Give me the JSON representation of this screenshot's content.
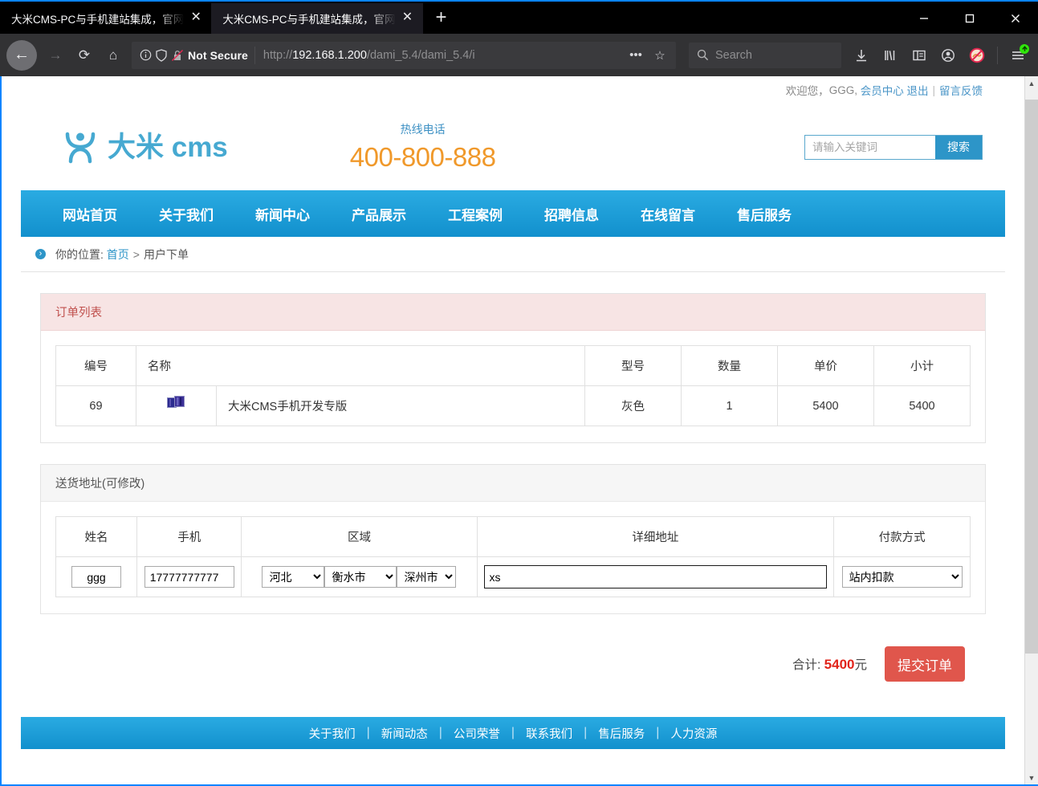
{
  "browser": {
    "tabs": [
      {
        "title": "大米CMS-PC与手机建站集成，官网",
        "close": "✕",
        "active": false
      },
      {
        "title": "大米CMS-PC与手机建站集成，官网",
        "close": "✕",
        "active": true
      }
    ],
    "new_tab_label": "+",
    "window_controls": {
      "minimize": "minimize-icon",
      "maximize": "maximize-icon",
      "close": "close-icon"
    },
    "nav": {
      "back": "←",
      "forward": "→",
      "reload": "⟳",
      "home": "⌂"
    },
    "address": {
      "security_label": "Not Secure",
      "url_scheme": "http://",
      "url_host": "192.168.1.200",
      "url_path": "/dami_5.4/dami_5.4/i",
      "page_actions": "•••",
      "bookmark": "☆"
    },
    "search": {
      "placeholder": "Search"
    },
    "toolbar_icons": [
      "downloads-icon",
      "library-icon",
      "sidebar-icon",
      "account-icon",
      "tracking-blocked-icon",
      "app-menu-icon"
    ]
  },
  "site": {
    "topbar": {
      "welcome": "欢迎您，",
      "username": "GGG,",
      "member_center": "会员中心",
      "logout": "退出",
      "divider": "|",
      "feedback": "留言反馈"
    },
    "logo": {
      "text": "大米 cms",
      "mark": "dami-logo-icon"
    },
    "hotline": {
      "label": "热线电话",
      "number": "400-800-888"
    },
    "search": {
      "placeholder": "请输入关键词",
      "button": "搜索",
      "value": ""
    },
    "nav_items": [
      "网站首页",
      "关于我们",
      "新闻中心",
      "产品展示",
      "工程案例",
      "招聘信息",
      "在线留言",
      "售后服务"
    ],
    "breadcrumb": {
      "prefix": "你的位置:",
      "home": "首页",
      "sep": ">",
      "current": "用户下单"
    },
    "order_panel": {
      "title": "订单列表",
      "columns": [
        "编号",
        "名称",
        "型号",
        "数量",
        "单价",
        "小计"
      ],
      "rows": [
        {
          "id": "69",
          "thumb": "broken-image-icon",
          "name": "大米CMS手机开发专版",
          "model": "灰色",
          "qty": "1",
          "price": "5400",
          "subtotal": "5400"
        }
      ]
    },
    "address_panel": {
      "title": "送货地址(可修改)",
      "columns": [
        "姓名",
        "手机",
        "区域",
        "详细地址",
        "付款方式"
      ],
      "form": {
        "name": "ggg",
        "phone": "17777777777",
        "province": "河北",
        "city": "衡水市",
        "district": "深州市",
        "detail": "xs",
        "payment": "站内扣款"
      }
    },
    "total": {
      "label": "合计:",
      "amount": "5400",
      "unit": "元"
    },
    "submit_label": "提交订单",
    "footer_links": [
      "关于我们",
      "新闻动态",
      "公司荣誉",
      "联系我们",
      "售后服务",
      "人力资源"
    ],
    "colors": {
      "brand_blue": "#2d95c8",
      "nav_blue": "#1290cd",
      "hotline_orange": "#f0992b",
      "accent_red": "#e1231a",
      "submit_red": "#e0564c",
      "panel_pink": "#f7e4e4"
    }
  }
}
